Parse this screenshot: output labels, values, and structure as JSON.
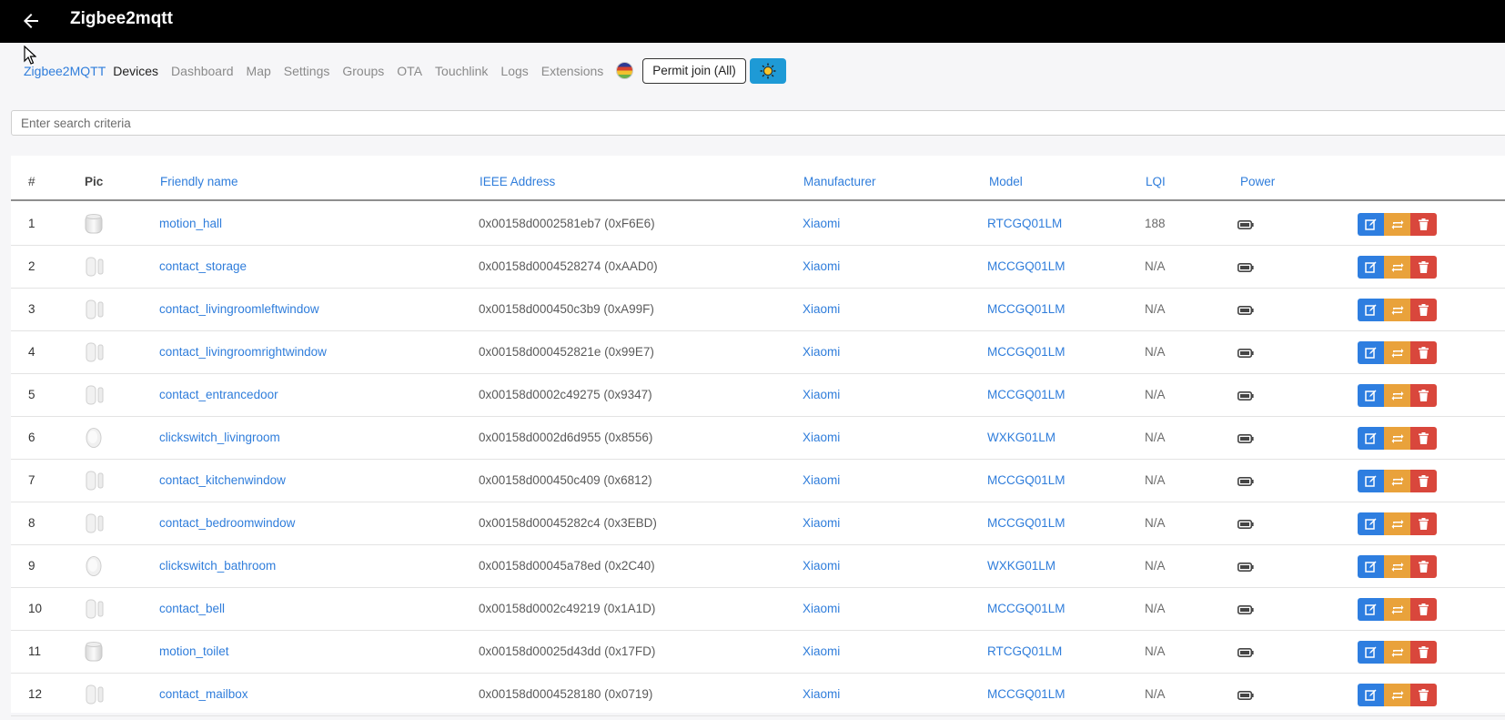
{
  "topbar": {
    "title": "Zigbee2mqtt"
  },
  "nav": {
    "brand": "Zigbee2MQTT",
    "items": [
      "Devices",
      "Dashboard",
      "Map",
      "Settings",
      "Groups",
      "OTA",
      "Touchlink",
      "Logs",
      "Extensions"
    ],
    "active": "Devices",
    "permit_join": "Permit join (All)"
  },
  "search": {
    "placeholder": "Enter search criteria"
  },
  "table": {
    "headers": {
      "num": "#",
      "pic": "Pic",
      "friendly_name": "Friendly name",
      "ieee": "IEEE Address",
      "manufacturer": "Manufacturer",
      "model": "Model",
      "lqi": "LQI",
      "power": "Power"
    },
    "rows": [
      {
        "num": "1",
        "pic": "motion-sensor-icon",
        "name": "motion_hall",
        "ieee": "0x00158d0002581eb7 (0xF6E6)",
        "manufacturer": "Xiaomi",
        "model": "RTCGQ01LM",
        "lqi": "188"
      },
      {
        "num": "2",
        "pic": "contact-sensor-icon",
        "name": "contact_storage",
        "ieee": "0x00158d0004528274 (0xAAD0)",
        "manufacturer": "Xiaomi",
        "model": "MCCGQ01LM",
        "lqi": "N/A"
      },
      {
        "num": "3",
        "pic": "contact-sensor-icon",
        "name": "contact_livingroomleftwindow",
        "ieee": "0x00158d000450c3b9 (0xA99F)",
        "manufacturer": "Xiaomi",
        "model": "MCCGQ01LM",
        "lqi": "N/A"
      },
      {
        "num": "4",
        "pic": "contact-sensor-icon",
        "name": "contact_livingroomrightwindow",
        "ieee": "0x00158d000452821e (0x99E7)",
        "manufacturer": "Xiaomi",
        "model": "MCCGQ01LM",
        "lqi": "N/A"
      },
      {
        "num": "5",
        "pic": "contact-sensor-icon",
        "name": "contact_entrancedoor",
        "ieee": "0x00158d0002c49275 (0x9347)",
        "manufacturer": "Xiaomi",
        "model": "MCCGQ01LM",
        "lqi": "N/A"
      },
      {
        "num": "6",
        "pic": "wireless-switch-icon",
        "name": "clickswitch_livingroom",
        "ieee": "0x00158d0002d6d955 (0x8556)",
        "manufacturer": "Xiaomi",
        "model": "WXKG01LM",
        "lqi": "N/A"
      },
      {
        "num": "7",
        "pic": "contact-sensor-icon",
        "name": "contact_kitchenwindow",
        "ieee": "0x00158d000450c409 (0x6812)",
        "manufacturer": "Xiaomi",
        "model": "MCCGQ01LM",
        "lqi": "N/A"
      },
      {
        "num": "8",
        "pic": "contact-sensor-icon",
        "name": "contact_bedroomwindow",
        "ieee": "0x00158d00045282c4 (0x3EBD)",
        "manufacturer": "Xiaomi",
        "model": "MCCGQ01LM",
        "lqi": "N/A"
      },
      {
        "num": "9",
        "pic": "wireless-switch-icon",
        "name": "clickswitch_bathroom",
        "ieee": "0x00158d00045a78ed (0x2C40)",
        "manufacturer": "Xiaomi",
        "model": "WXKG01LM",
        "lqi": "N/A"
      },
      {
        "num": "10",
        "pic": "contact-sensor-icon",
        "name": "contact_bell",
        "ieee": "0x00158d0002c49219 (0x1A1D)",
        "manufacturer": "Xiaomi",
        "model": "MCCGQ01LM",
        "lqi": "N/A"
      },
      {
        "num": "11",
        "pic": "motion-sensor-icon",
        "name": "motion_toilet",
        "ieee": "0x00158d00025d43dd (0x17FD)",
        "manufacturer": "Xiaomi",
        "model": "RTCGQ01LM",
        "lqi": "N/A"
      },
      {
        "num": "12",
        "pic": "contact-sensor-icon",
        "name": "contact_mailbox",
        "ieee": "0x00158d0004528180 (0x0719)",
        "manufacturer": "Xiaomi",
        "model": "MCCGQ01LM",
        "lqi": "N/A"
      }
    ]
  },
  "colors": {
    "link": "#2f7ddb",
    "edit": "#2e7ee0",
    "rename": "#e9a23b",
    "delete": "#d9473c",
    "theme_button": "#1e9ad6"
  }
}
